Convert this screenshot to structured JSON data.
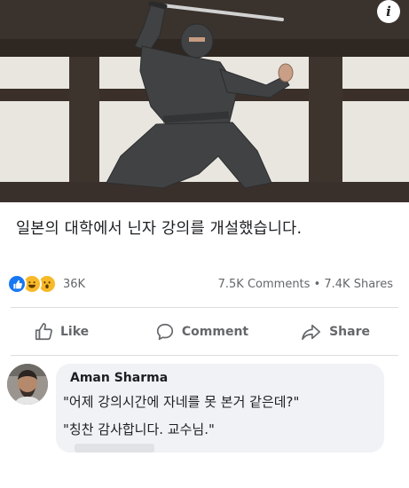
{
  "post": {
    "caption": "일본의 대학에서 닌자 강의를 개설했습니다.",
    "info_icon": "i"
  },
  "photo": {
    "subject": "ninja-icon",
    "colors": {
      "wall": "#e9e6e0",
      "beam": "#3a2f29",
      "ninja": "#3f4042",
      "blade": "#c8c8c8"
    }
  },
  "reactions": {
    "icons": [
      "like-icon",
      "haha-icon",
      "wow-icon"
    ],
    "count": "36K"
  },
  "stats": {
    "comments": "7.5K Comments",
    "separator": "•",
    "shares": "7.4K Shares"
  },
  "actions": {
    "like": "Like",
    "comment": "Comment",
    "share": "Share"
  },
  "comment": {
    "author": "Aman Sharma",
    "line1": "\"어제 강의시간에 자네를 못 본거 같은데?\"",
    "line2": "\"칭찬 감사합니다. 교수님.\""
  },
  "colors": {
    "accent": "#1877f2",
    "reaction_yellow": "#f7b928",
    "text_secondary": "#65676b",
    "bubble": "#f0f2f5"
  }
}
